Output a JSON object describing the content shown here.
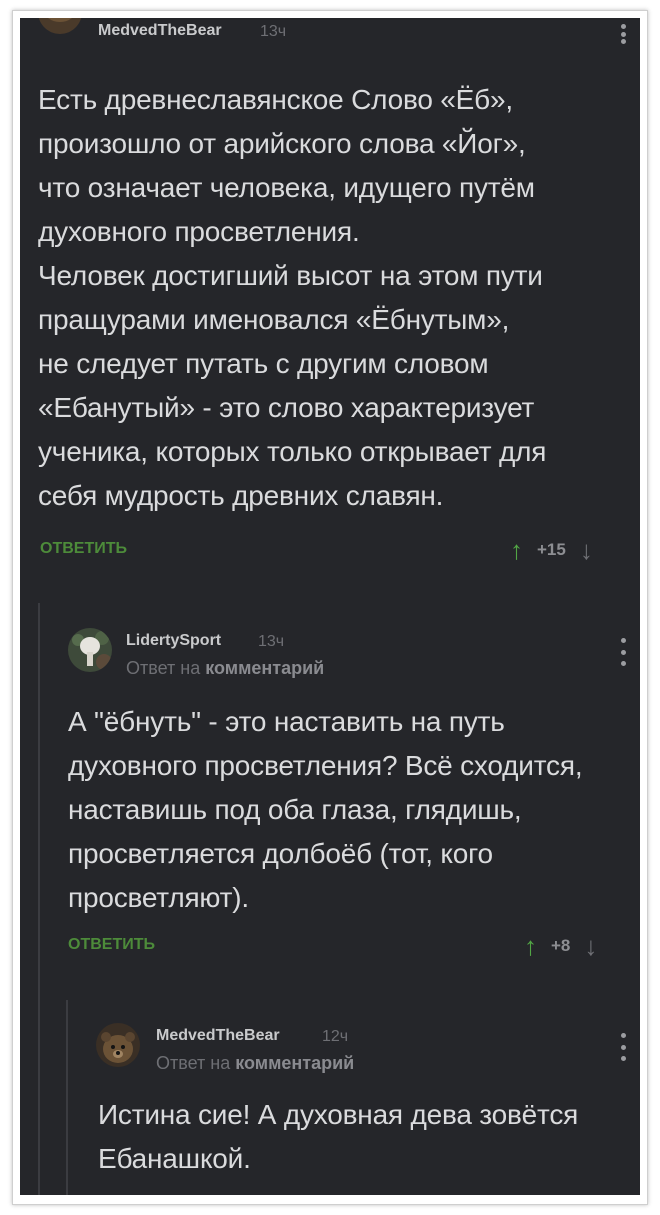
{
  "comments": [
    {
      "author": "MedvedTheBear",
      "time": "13ч",
      "text": "Есть древнеславянское Слово «Ёб»,\nпроизошло от арийского слова «Йог»,\nчто означает человека, идущего путём\nдуховного просветления.\nЧеловек достигший высот на этом пути\nпращурами именовался «Ёбнутым»,\nне следует путать с другим словом\n«Ебанутый» - это слово характеризует\nученика, которых только открывает для\nсебя мудрость древних славян.",
      "reply_label": "ОТВЕТИТЬ",
      "score": "+15",
      "avatar_icon": "bear-avatar-icon"
    },
    {
      "author": "LidertySport",
      "time": "13ч",
      "reply_to_prefix": "Ответ на",
      "reply_to_link": "комментарий",
      "text": "А \"ёбнуть\" - это наставить на путь\nдуховного просветления? Всё сходится,\nнаставишь под оба глаза, глядишь,\nпросветляется долбоёб (тот, кого\nпросветляют).",
      "reply_label": "ОТВЕТИТЬ",
      "score": "+8",
      "avatar_icon": "mushroom-avatar-icon"
    },
    {
      "author": "MedvedTheBear",
      "time": "12ч",
      "reply_to_prefix": "Ответ на",
      "reply_to_link": "комментарий",
      "text": "Истина сие! А духовная дева зовётся\nЕбанашкой.",
      "avatar_icon": "bear-avatar-icon"
    }
  ],
  "icons": {
    "upvote": "arrow-up-icon",
    "downvote": "arrow-down-icon",
    "menu": "more-vertical-icon"
  },
  "colors": {
    "background": "#25262a",
    "text": "#dadbdd",
    "accent_green": "#4d8b3a",
    "upvote_green": "#52a645",
    "muted": "#6e6f74"
  }
}
